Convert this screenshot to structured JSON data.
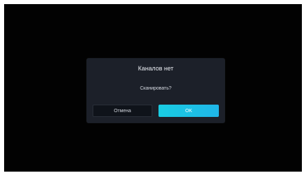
{
  "dialog": {
    "title": "Каналов нет",
    "message": "Сканировать?",
    "cancel_label": "Отмена",
    "ok_label": "OK"
  },
  "colors": {
    "background": "#020202",
    "dialog": "#1c2029",
    "accent": "#19cde3"
  }
}
